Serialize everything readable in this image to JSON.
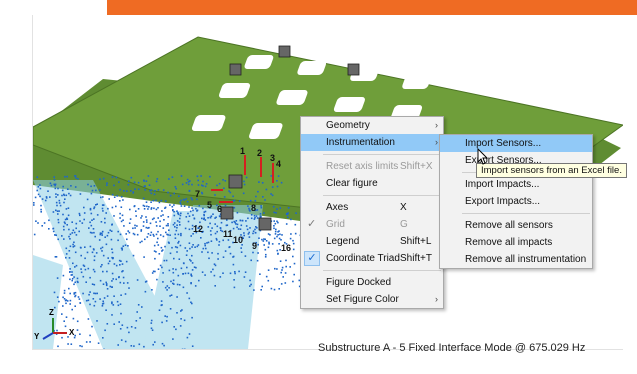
{
  "caption": "Substructure A - 5 Fixed Interface Mode @ 675.029 Hz",
  "triad": {
    "z": "Z",
    "y": "Y",
    "x": "X"
  },
  "sensor_labels": [
    "1",
    "2",
    "3",
    "4",
    "5",
    "6",
    "7",
    "8",
    "9",
    "10",
    "11",
    "12",
    "16"
  ],
  "context_menu": {
    "geometry": "Geometry",
    "instrumentation": "Instrumentation",
    "reset_axis_limits": "Reset axis limits",
    "reset_axis_limits_shortcut": "Shift+X",
    "clear_figure": "Clear figure",
    "axes": "Axes",
    "axes_shortcut": "X",
    "grid": "Grid",
    "grid_shortcut": "G",
    "legend": "Legend",
    "legend_shortcut": "Shift+L",
    "coordinate_triad": "Coordinate Triad",
    "coordinate_triad_shortcut": "Shift+T",
    "figure_docked": "Figure Docked",
    "set_figure_color": "Set Figure Color"
  },
  "submenu": {
    "import_sensors": "Import Sensors...",
    "export_sensors": "Export Sensors...",
    "import_impacts": "Import Impacts...",
    "export_impacts": "Export Impacts...",
    "remove_all_sensors": "Remove all sensors",
    "remove_all_impacts": "Remove all impacts",
    "remove_all_instrumentation": "Remove all instrumentation"
  },
  "tooltip": "Import sensors from an Excel file.",
  "colors": {
    "accent_bar": "#ef6b23",
    "plate": "#6f9e3a",
    "highlight": "#91c9f7",
    "points": "#1f66c9"
  }
}
